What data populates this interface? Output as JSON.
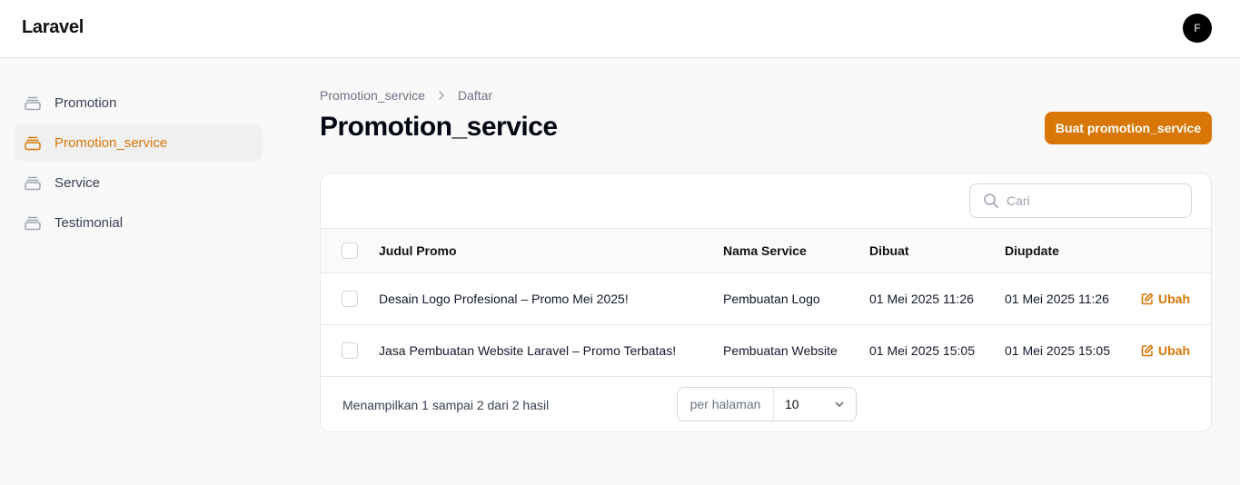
{
  "app": {
    "brand": "Laravel",
    "user_initial": "F",
    "accent_color": "#d97706"
  },
  "sidebar": {
    "items": [
      {
        "label": "Promotion",
        "icon": "rectangle-stack-icon",
        "active": false
      },
      {
        "label": "Promotion_service",
        "icon": "rectangle-stack-icon",
        "active": true
      },
      {
        "label": "Service",
        "icon": "rectangle-stack-icon",
        "active": false
      },
      {
        "label": "Testimonial",
        "icon": "rectangle-stack-icon",
        "active": false
      }
    ]
  },
  "breadcrumb": {
    "parent": "Promotion_service",
    "current": "Daftar"
  },
  "page": {
    "title": "Promotion_service",
    "create_button": "Buat promotion_service"
  },
  "search": {
    "placeholder": "Cari",
    "value": ""
  },
  "table": {
    "columns": [
      "Judul Promo",
      "Nama Service",
      "Dibuat",
      "Diupdate"
    ],
    "rows": [
      {
        "title": "Desain Logo Profesional – Promo Mei 2025!",
        "service": "Pembuatan Logo",
        "created": "01 Mei 2025 11:26",
        "updated": "01 Mei 2025 11:26",
        "action": "Ubah"
      },
      {
        "title": "Jasa Pembuatan Website Laravel – Promo Terbatas!",
        "service": "Pembuatan Website",
        "created": "01 Mei 2025 15:05",
        "updated": "01 Mei 2025 15:05",
        "action": "Ubah"
      }
    ]
  },
  "pagination": {
    "summary": "Menampilkan 1 sampai 2 dari 2 hasil",
    "per_page_label": "per halaman",
    "per_page_value": "10"
  }
}
